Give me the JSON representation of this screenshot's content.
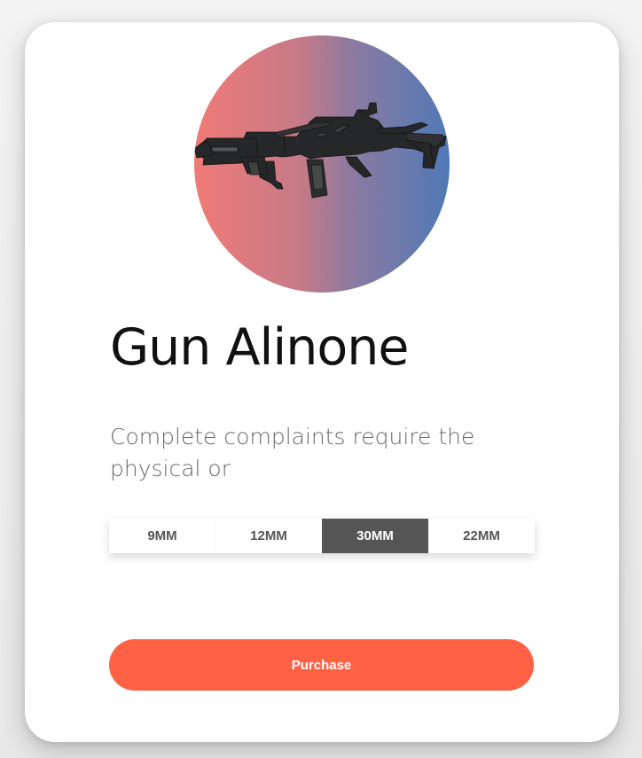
{
  "product": {
    "title": "Gun Alinone",
    "description": "Complete complaints require the physical or",
    "image_icon": "rifle-icon",
    "sizes": [
      {
        "label": "9MM",
        "selected": false
      },
      {
        "label": "12MM",
        "selected": false
      },
      {
        "label": "30MM",
        "selected": true
      },
      {
        "label": "22MM",
        "selected": false
      }
    ],
    "purchase_label": "Purchase"
  },
  "colors": {
    "accent": "#ff6145",
    "selected_size_bg": "#555555",
    "image_gradient_left": "#f07a76",
    "image_gradient_right": "#4f79b6"
  }
}
